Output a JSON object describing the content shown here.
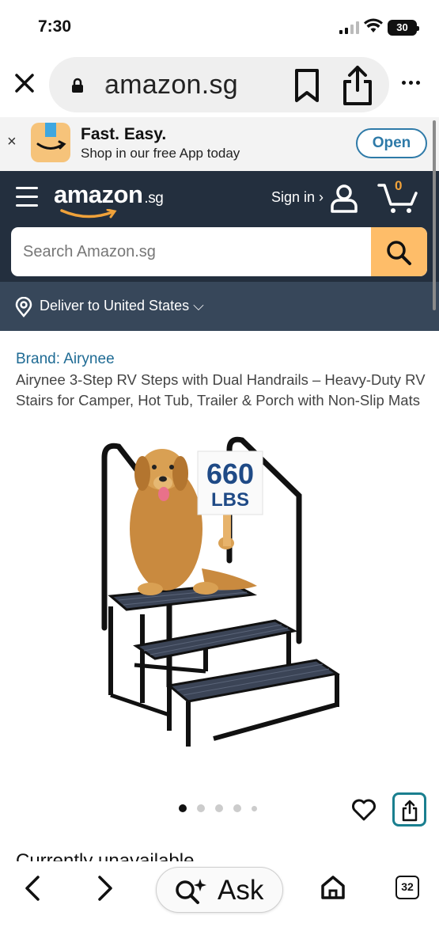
{
  "status_bar": {
    "time": "7:30",
    "battery": "30"
  },
  "browser": {
    "domain": "amazon.sg",
    "close_icon": "close-icon",
    "bookmark_icon": "bookmark-icon",
    "share_icon": "share-icon",
    "more_icon": "more-icon"
  },
  "app_banner": {
    "title": "Fast. Easy.",
    "subtitle": "Shop in our free App today",
    "open_label": "Open",
    "dismiss": "×"
  },
  "header": {
    "logo": "amazon",
    "logo_suffix": ".sg",
    "sign_in": "Sign in ›",
    "cart_count": "0",
    "search_placeholder": "Search Amazon.sg",
    "accent_color": "#febd69",
    "nav_color": "#232f3e"
  },
  "deliver": {
    "label": "Deliver to United States ⌵"
  },
  "product": {
    "brand": "Brand: Airynee",
    "title": "Airynee 3-Step RV Steps with Dual Handrails – Heavy-Duty RV Stairs for Camper, Hot Tub, Trailer & Porch with Non-Slip Mats",
    "sign_number": "660",
    "sign_unit": "LBS",
    "image_count": 5,
    "active_image": 1,
    "availability": "Currently unavailable"
  },
  "toolbar": {
    "ask_label": "Ask",
    "tab_count": "32"
  }
}
